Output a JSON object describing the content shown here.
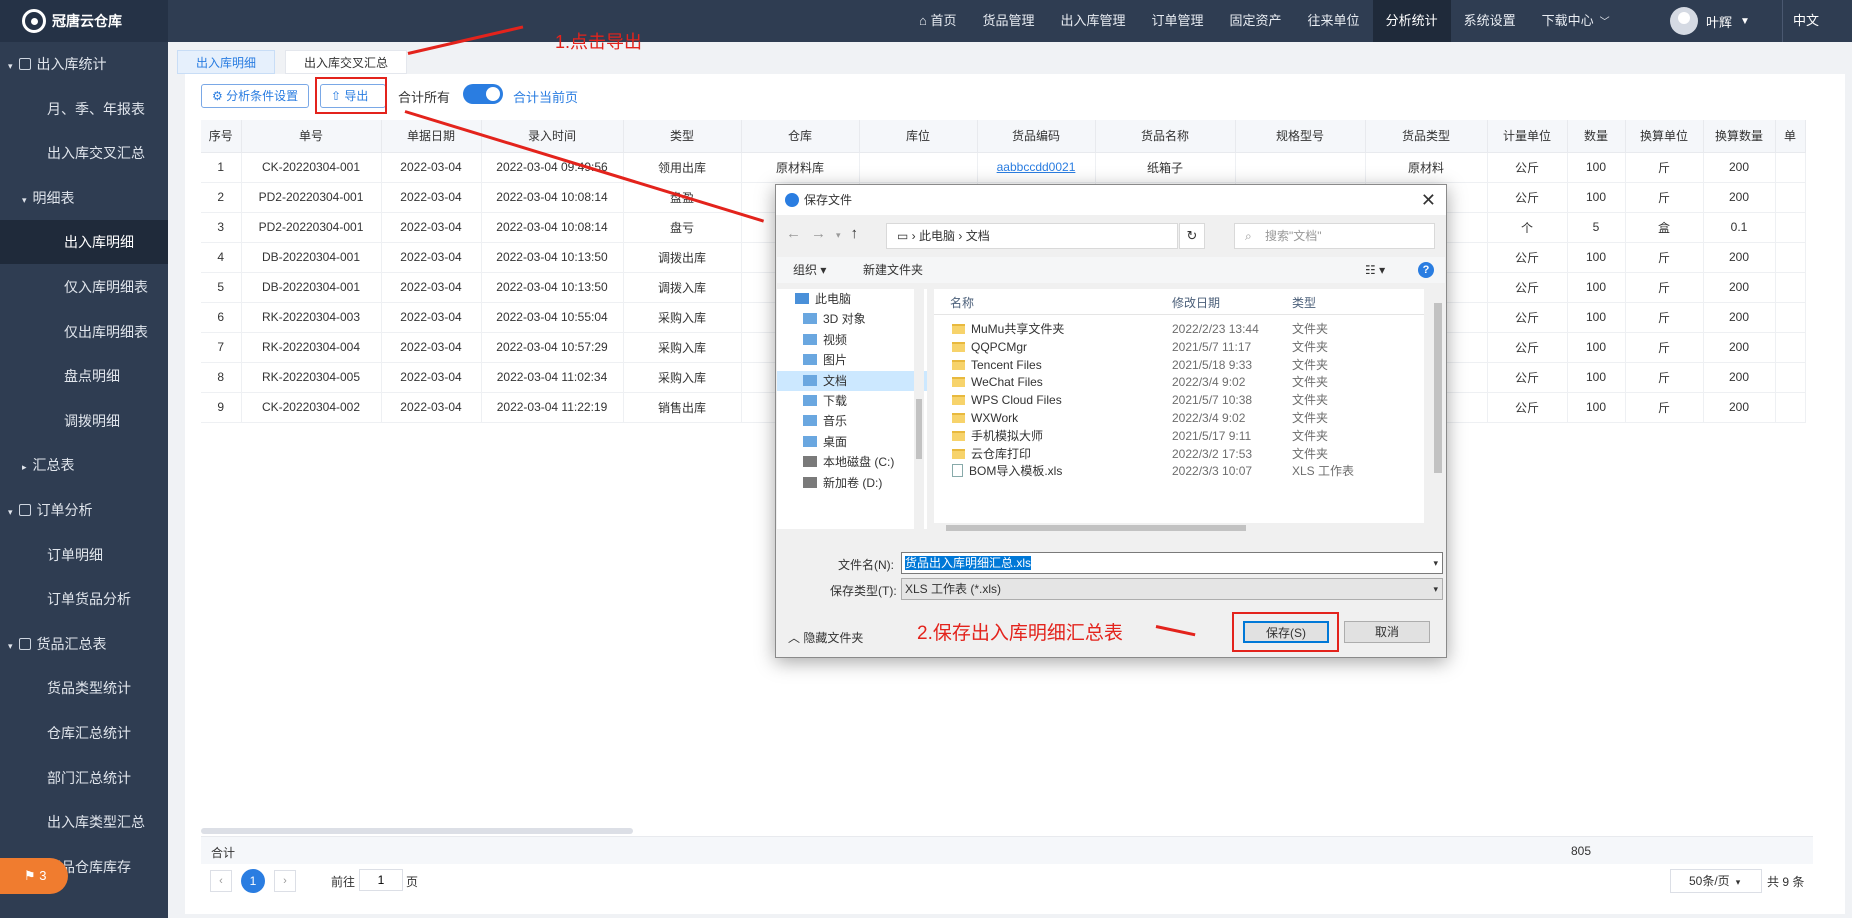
{
  "app": {
    "title": "冠唐云仓库"
  },
  "nav": [
    "首页",
    "货品管理",
    "出入库管理",
    "订单管理",
    "固定资产",
    "往来单位",
    "分析统计",
    "系统设置",
    "下载中心"
  ],
  "user": {
    "name": "叶辉",
    "lang": "中文"
  },
  "sidebar": [
    {
      "label": "出入库统计",
      "level": 0,
      "caret": "▾",
      "active": false
    },
    {
      "label": "月、季、年报表",
      "level": 1,
      "active": false
    },
    {
      "label": "出入库交叉汇总",
      "level": 1,
      "active": false
    },
    {
      "label": "明细表",
      "level": 1,
      "caret": "▾",
      "active": false
    },
    {
      "label": "出入库明细",
      "level": 2,
      "active": true
    },
    {
      "label": "仅入库明细表",
      "level": 2,
      "active": false
    },
    {
      "label": "仅出库明细表",
      "level": 2,
      "active": false
    },
    {
      "label": "盘点明细",
      "level": 2,
      "active": false
    },
    {
      "label": "调拨明细",
      "level": 2,
      "active": false
    },
    {
      "label": "汇总表",
      "level": 1,
      "caret": "▸",
      "active": false
    },
    {
      "label": "订单分析",
      "level": 0,
      "caret": "▾",
      "active": false
    },
    {
      "label": "订单明细",
      "level": 1,
      "active": false
    },
    {
      "label": "订单货品分析",
      "level": 1,
      "active": false
    },
    {
      "label": "货品汇总表",
      "level": 0,
      "caret": "▾",
      "active": false
    },
    {
      "label": "货品类型统计",
      "level": 1,
      "active": false
    },
    {
      "label": "仓库汇总统计",
      "level": 1,
      "active": false
    },
    {
      "label": "部门汇总统计",
      "level": 1,
      "active": false
    },
    {
      "label": "出入库类型汇总",
      "level": 1,
      "active": false
    },
    {
      "label": "货品仓库库存",
      "level": 1,
      "active": false
    }
  ],
  "tabs": [
    "出入库明细",
    "出入库交叉汇总"
  ],
  "toolbar": {
    "settings": "分析条件设置",
    "export": "导出",
    "sum_all": "合计所有",
    "sum_page": "合计当前页"
  },
  "table": {
    "headers": [
      "序号",
      "单号",
      "单据日期",
      "录入时间",
      "类型",
      "仓库",
      "库位",
      "货品编码",
      "货品名称",
      "规格型号",
      "货品类型",
      "计量单位",
      "数量",
      "换算单位",
      "换算数量",
      "单"
    ],
    "rows": [
      [
        "1",
        "CK-20220304-001",
        "2022-03-04",
        "2022-03-04 09:49:56",
        "领用出库",
        "原材料库",
        "",
        "aabbccdd0021",
        "纸箱子",
        "",
        "原材料",
        "公斤",
        "100",
        "斤",
        "200"
      ],
      [
        "2",
        "PD2-20220304-001",
        "2022-03-04",
        "2022-03-04 10:08:14",
        "盘盈",
        "",
        "",
        "",
        "",
        "",
        "",
        "公斤",
        "100",
        "斤",
        "200"
      ],
      [
        "3",
        "PD2-20220304-001",
        "2022-03-04",
        "2022-03-04 10:08:14",
        "盘亏",
        "",
        "",
        "",
        "",
        "",
        "",
        "个",
        "5",
        "盒",
        "0.1"
      ],
      [
        "4",
        "DB-20220304-001",
        "2022-03-04",
        "2022-03-04 10:13:50",
        "调拨出库",
        "",
        "",
        "",
        "",
        "",
        "",
        "公斤",
        "100",
        "斤",
        "200"
      ],
      [
        "5",
        "DB-20220304-001",
        "2022-03-04",
        "2022-03-04 10:13:50",
        "调拨入库",
        "",
        "",
        "",
        "",
        "",
        "",
        "公斤",
        "100",
        "斤",
        "200"
      ],
      [
        "6",
        "RK-20220304-003",
        "2022-03-04",
        "2022-03-04 10:55:04",
        "采购入库",
        "",
        "",
        "",
        "",
        "",
        "",
        "公斤",
        "100",
        "斤",
        "200"
      ],
      [
        "7",
        "RK-20220304-004",
        "2022-03-04",
        "2022-03-04 10:57:29",
        "采购入库",
        "",
        "",
        "",
        "",
        "",
        "",
        "公斤",
        "100",
        "斤",
        "200"
      ],
      [
        "8",
        "RK-20220304-005",
        "2022-03-04",
        "2022-03-04 11:02:34",
        "采购入库",
        "",
        "",
        "",
        "",
        "",
        "",
        "公斤",
        "100",
        "斤",
        "200"
      ],
      [
        "9",
        "CK-20220304-002",
        "2022-03-04",
        "2022-03-04 11:22:19",
        "销售出库",
        "",
        "",
        "",
        "",
        "",
        "",
        "公斤",
        "100",
        "斤",
        "200"
      ]
    ],
    "sum_label": "合计",
    "sum_qty": "805"
  },
  "pager": {
    "current": "1",
    "goto_prefix": "前往",
    "goto_value": "1",
    "goto_suffix": "页",
    "page_size": "50条/页",
    "total": "共 9 条"
  },
  "annotations": {
    "step1": "1.点击导出",
    "step2": "2.保存出入库明细汇总表"
  },
  "dialog": {
    "title": "保存文件",
    "path": [
      "此电脑",
      "文档"
    ],
    "search_placeholder": "搜索\"文档\"",
    "organize": "组织",
    "new_folder": "新建文件夹",
    "tree": [
      "此电脑",
      "3D 对象",
      "视频",
      "图片",
      "文档",
      "下载",
      "音乐",
      "桌面",
      "本地磁盘 (C:)",
      "新加卷 (D:)"
    ],
    "tree_selected": "文档",
    "columns": [
      "名称",
      "修改日期",
      "类型"
    ],
    "files": [
      {
        "name": "MuMu共享文件夹",
        "date": "2022/2/23 13:44",
        "type": "文件夹",
        "kind": "folder"
      },
      {
        "name": "QQPCMgr",
        "date": "2021/5/7 11:17",
        "type": "文件夹",
        "kind": "folder"
      },
      {
        "name": "Tencent Files",
        "date": "2021/5/18 9:33",
        "type": "文件夹",
        "kind": "folder"
      },
      {
        "name": "WeChat Files",
        "date": "2022/3/4 9:02",
        "type": "文件夹",
        "kind": "folder"
      },
      {
        "name": "WPS Cloud Files",
        "date": "2021/5/7 10:38",
        "type": "文件夹",
        "kind": "folder"
      },
      {
        "name": "WXWork",
        "date": "2022/3/4 9:02",
        "type": "文件夹",
        "kind": "folder"
      },
      {
        "name": "手机模拟大师",
        "date": "2021/5/17 9:11",
        "type": "文件夹",
        "kind": "folder"
      },
      {
        "name": "云仓库打印",
        "date": "2022/3/2 17:53",
        "type": "文件夹",
        "kind": "folder"
      },
      {
        "name": "BOM导入模板.xls",
        "date": "2022/3/3 10:07",
        "type": "XLS 工作表",
        "kind": "xls"
      }
    ],
    "filename_label": "文件名(N):",
    "filename": "货品出入库明细汇总.xls",
    "filetype_label": "保存类型(T):",
    "filetype": "XLS 工作表 (*.xls)",
    "hide_folders": "隐藏文件夹",
    "save": "保存(S)",
    "cancel": "取消"
  },
  "notif_count": "3",
  "colors": {
    "accent": "#2a7de1",
    "annotation": "#e3231c",
    "sidebar": "#2f3d52"
  }
}
